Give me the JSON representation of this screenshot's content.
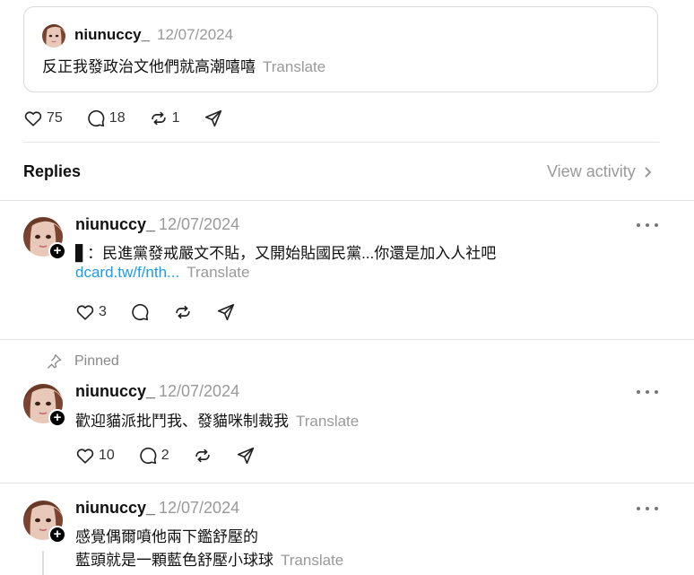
{
  "quoted_post": {
    "username": "niunuccy_",
    "date": "12/07/2024",
    "text": "反正我發政治文他們就高潮嘻嘻",
    "translate": "Translate",
    "likes": "75",
    "comments": "18",
    "reposts": "1"
  },
  "replies_header": {
    "title": "Replies",
    "view_activity": "View activity"
  },
  "replies": [
    {
      "username": "niunuccy_",
      "date": "12/07/2024",
      "text": "▋：民進黨發戒嚴文不貼，又開始貼國民黨...你還是加入人社吧",
      "link": "dcard.tw/f/nth...",
      "translate": "Translate",
      "likes": "3",
      "comments": ""
    },
    {
      "pinned_label": "Pinned",
      "username": "niunuccy_",
      "date": "12/07/2024",
      "text": "歡迎貓派批鬥我、發貓咪制裁我",
      "translate": "Translate",
      "likes": "10",
      "comments": "2"
    },
    {
      "username": "niunuccy_",
      "date": "12/07/2024",
      "text_line1": "感覺偶爾噴他兩下鑑舒壓的",
      "text_line2": "藍頭就是一顆藍色舒壓小球球",
      "translate": "Translate"
    }
  ],
  "icons": {
    "like": "heart-icon",
    "comment": "comment-icon",
    "repost": "repost-icon",
    "share": "share-icon",
    "more": "more-icon",
    "pin": "pin-icon"
  },
  "colors": {
    "muted": "#999999",
    "link": "#1d9bf0",
    "divider": "#e0e0e0"
  }
}
